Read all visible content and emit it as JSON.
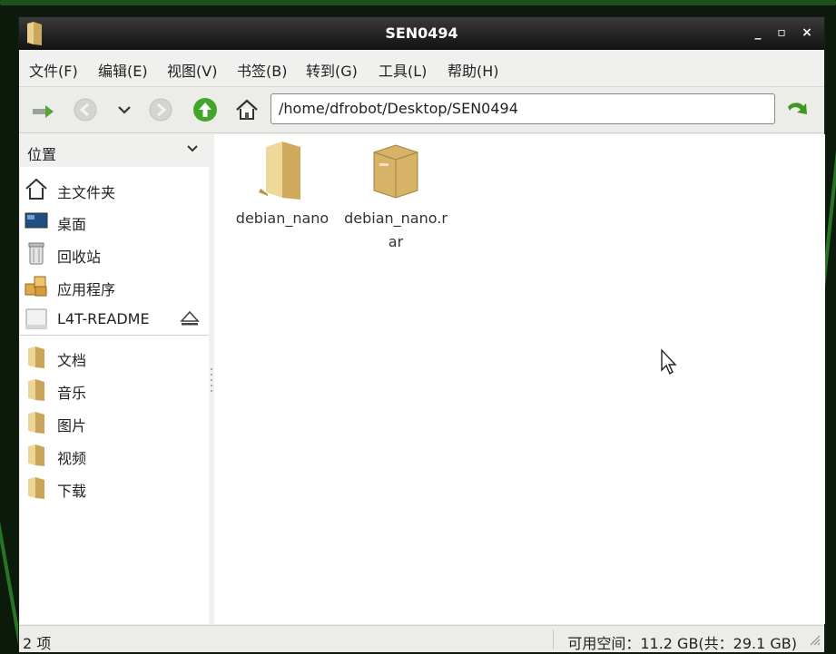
{
  "window": {
    "title": "SEN0494",
    "controls": [
      "_",
      "▫",
      "×"
    ]
  },
  "menubar": {
    "items": [
      "文件(F)",
      "编辑(E)",
      "视图(V)",
      "书签(B)",
      "转到(G)",
      "工具(L)",
      "帮助(H)"
    ]
  },
  "toolbar": {
    "address": "/home/dfrobot/Desktop/SEN0494",
    "icons": [
      "new-tab-icon",
      "back-icon",
      "history-dropdown-icon",
      "forward-icon",
      "up-icon",
      "home-icon",
      "go-icon"
    ]
  },
  "sidebar": {
    "header": "位置",
    "places": [
      {
        "label": "主文件夹",
        "icon": "home-icon"
      },
      {
        "label": "桌面",
        "icon": "desktop-icon"
      },
      {
        "label": "回收站",
        "icon": "trash-icon"
      },
      {
        "label": "应用程序",
        "icon": "applications-icon"
      },
      {
        "label": "L4T-README",
        "icon": "drive-icon"
      }
    ],
    "bookmarks": [
      {
        "label": "文档",
        "icon": "folder-icon"
      },
      {
        "label": "音乐",
        "icon": "folder-icon"
      },
      {
        "label": "图片",
        "icon": "folder-icon"
      },
      {
        "label": "视频",
        "icon": "folder-icon"
      },
      {
        "label": "下载",
        "icon": "folder-icon"
      }
    ]
  },
  "files": [
    {
      "name": "debian_nano",
      "icon": "folder-icon"
    },
    {
      "name": "debian_nano.rar",
      "icon": "archive-icon"
    }
  ],
  "statusbar": {
    "count": "2 项",
    "space": "可用空间：11.2 GB(共：29.1 GB)"
  },
  "colors": {
    "titlebar": "#1e1e1e",
    "folder": "#d9b870",
    "go_arrow": "#3c9a1f",
    "up_arrow": "#43a52b"
  }
}
